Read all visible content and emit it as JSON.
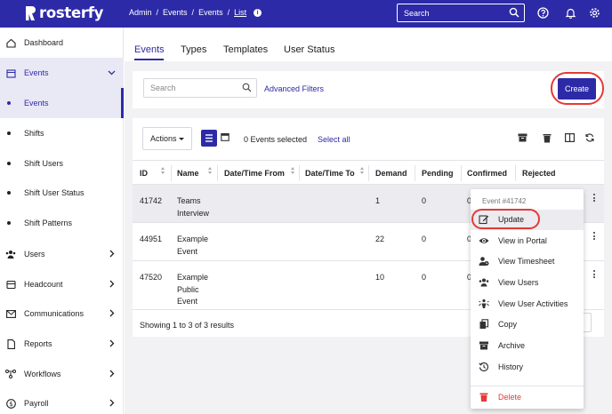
{
  "app": {
    "brand": "rosterfy"
  },
  "breadcrumb": {
    "items": [
      "Admin",
      "Events",
      "Events"
    ],
    "current": "List"
  },
  "top_search": {
    "placeholder": "Search"
  },
  "sidebar": {
    "items": [
      {
        "label": "Dashboard",
        "icon": "home-icon"
      },
      {
        "label": "Events",
        "icon": "calendar-icon",
        "expanded": true
      },
      {
        "label": "Events",
        "sub": true,
        "active": true
      },
      {
        "label": "Shifts",
        "sub": true
      },
      {
        "label": "Shift Users",
        "sub": true
      },
      {
        "label": "Shift User Status",
        "sub": true
      },
      {
        "label": "Shift Patterns",
        "sub": true
      },
      {
        "label": "Users",
        "icon": "users-icon"
      },
      {
        "label": "Headcount",
        "icon": "headcount-icon"
      },
      {
        "label": "Communications",
        "icon": "envelope-icon"
      },
      {
        "label": "Reports",
        "icon": "document-icon"
      },
      {
        "label": "Workflows",
        "icon": "workflow-icon"
      },
      {
        "label": "Payroll",
        "icon": "dollar-icon"
      }
    ]
  },
  "tabs": [
    "Events",
    "Types",
    "Templates",
    "User Status"
  ],
  "filters": {
    "search_placeholder": "Search",
    "advanced_label": "Advanced Filters",
    "create_label": "Create"
  },
  "toolbar": {
    "actions_label": "Actions",
    "selected_text": "0 Events selected",
    "select_all_label": "Select all"
  },
  "table": {
    "columns": [
      "ID",
      "Name",
      "Date/Time From",
      "Date/Time To",
      "Demand",
      "Pending",
      "Confirmed",
      "Rejected"
    ],
    "rows": [
      {
        "id": "41742",
        "name": [
          "Teams",
          "Interview"
        ],
        "demand": "1",
        "pending": "0",
        "confirmed": "0"
      },
      {
        "id": "44951",
        "name": [
          "Example",
          "Event"
        ],
        "demand": "22",
        "pending": "0",
        "confirmed": "0"
      },
      {
        "id": "47520",
        "name": [
          "Example",
          "Public",
          "Event"
        ],
        "demand": "10",
        "pending": "0",
        "confirmed": "0"
      }
    ],
    "footer": "Showing 1 to 3 of 3 results"
  },
  "row_menu": {
    "header": "Event #41742",
    "items": [
      {
        "label": "Update",
        "icon": "pencil-square-icon"
      },
      {
        "label": "View in Portal",
        "icon": "eye-icon"
      },
      {
        "label": "View Timesheet",
        "icon": "user-clock-icon"
      },
      {
        "label": "View Users",
        "icon": "users-icon"
      },
      {
        "label": "View User Activities",
        "icon": "activity-icon"
      },
      {
        "label": "Copy",
        "icon": "copy-icon"
      },
      {
        "label": "Archive",
        "icon": "archive-icon"
      },
      {
        "label": "History",
        "icon": "history-icon"
      },
      {
        "label": "Delete",
        "icon": "trash-icon"
      }
    ]
  },
  "colors": {
    "brand": "#2d2aa8",
    "danger": "#e53935",
    "highlight_ring": "#e53935"
  }
}
